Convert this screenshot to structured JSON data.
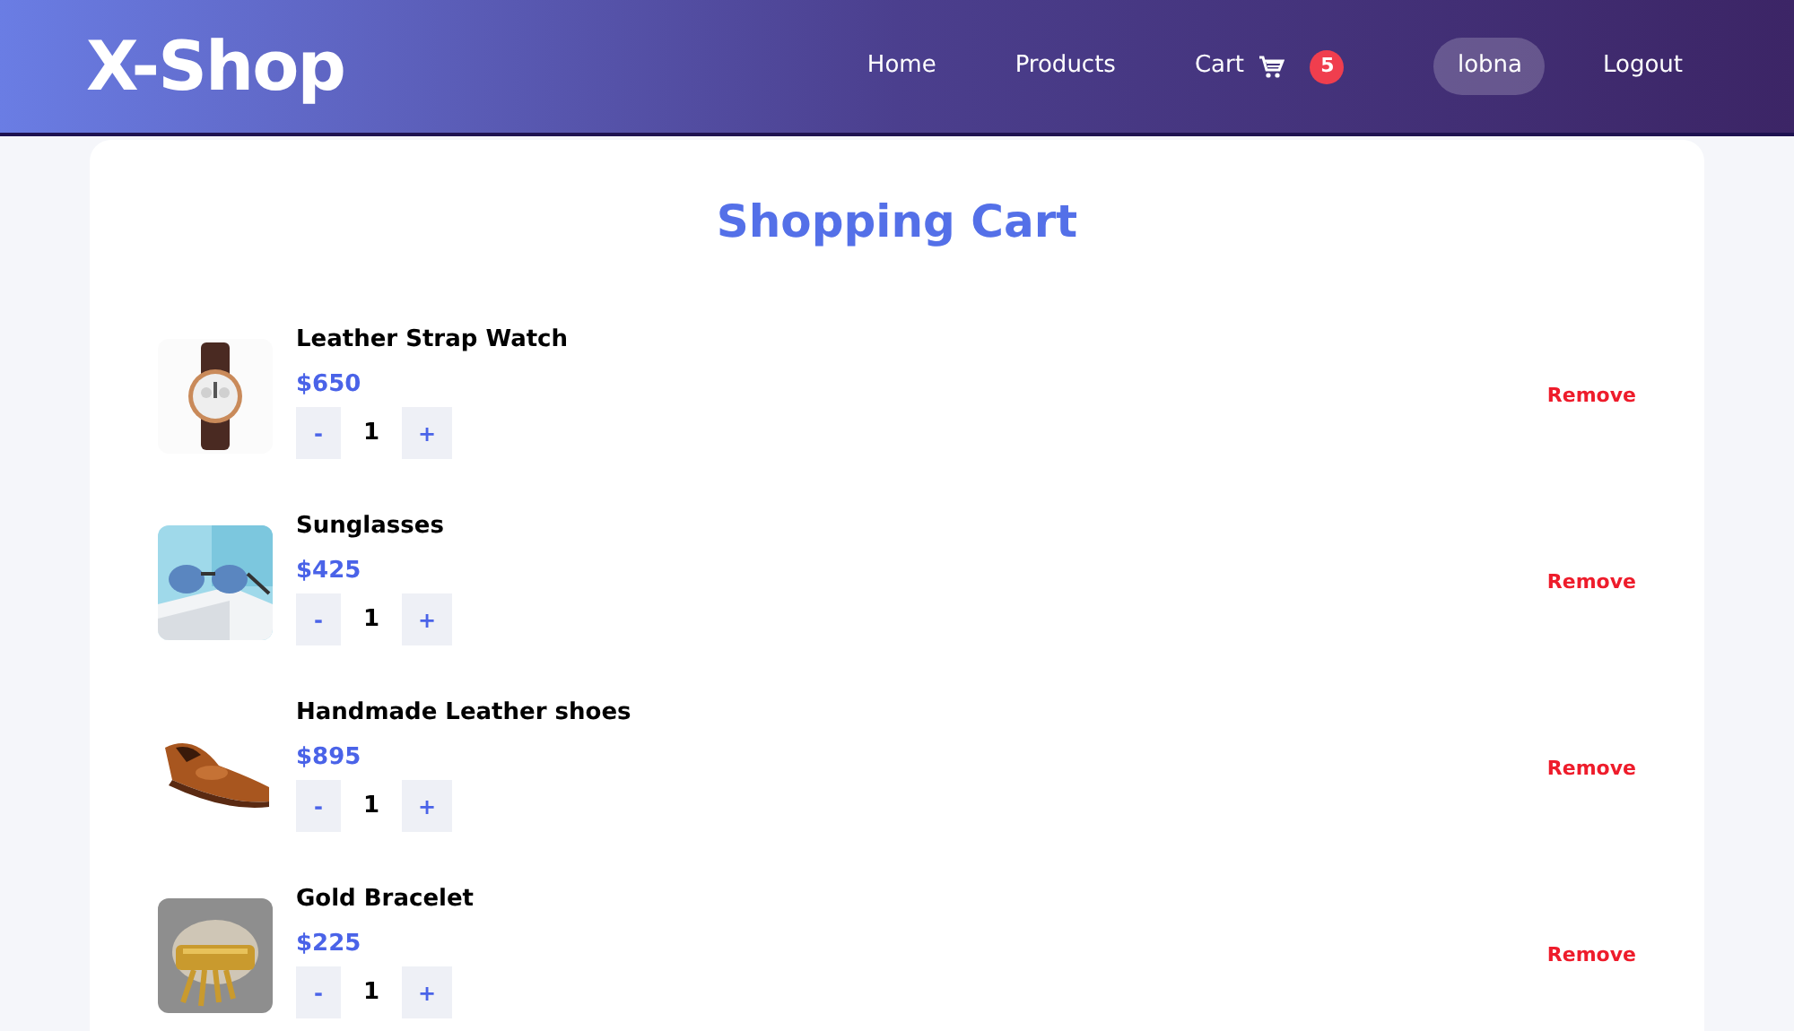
{
  "header": {
    "logo": "X-Shop",
    "nav": [
      {
        "label": "Home",
        "kind": "link"
      },
      {
        "label": "Products",
        "kind": "link"
      },
      {
        "label": "Cart",
        "kind": "cart",
        "badge": "5"
      },
      {
        "label": "lobna",
        "kind": "user"
      },
      {
        "label": "Logout",
        "kind": "link"
      }
    ]
  },
  "cart": {
    "title": "Shopping Cart",
    "items": [
      {
        "name": "Leather Strap Watch",
        "price": "$650",
        "quantity": "1",
        "decrement": "-",
        "increment": "+",
        "remove": "Remove"
      },
      {
        "name": "Sunglasses",
        "price": "$425",
        "quantity": "1",
        "decrement": "-",
        "increment": "+",
        "remove": "Remove"
      },
      {
        "name": "Handmade Leather shoes",
        "price": "$895",
        "quantity": "1",
        "decrement": "-",
        "increment": "+",
        "remove": "Remove"
      },
      {
        "name": "Gold Bracelet",
        "price": "$225",
        "quantity": "1",
        "decrement": "-",
        "increment": "+",
        "remove": "Remove"
      }
    ]
  }
}
